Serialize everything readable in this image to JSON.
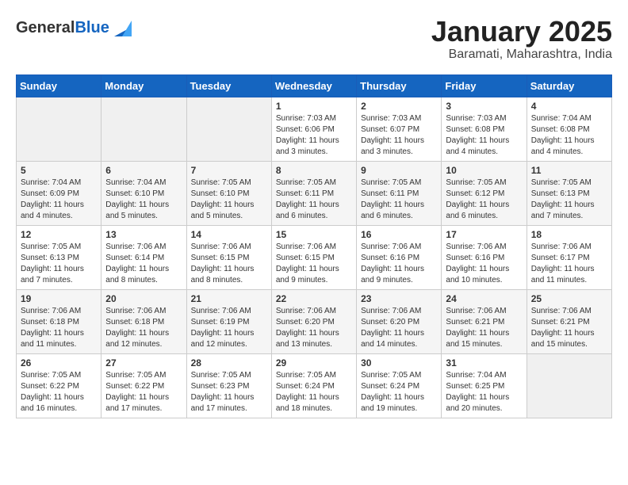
{
  "header": {
    "logo_general": "General",
    "logo_blue": "Blue",
    "month_title": "January 2025",
    "location": "Baramati, Maharashtra, India"
  },
  "days_of_week": [
    "Sunday",
    "Monday",
    "Tuesday",
    "Wednesday",
    "Thursday",
    "Friday",
    "Saturday"
  ],
  "weeks": [
    [
      {
        "day": "",
        "content": ""
      },
      {
        "day": "",
        "content": ""
      },
      {
        "day": "",
        "content": ""
      },
      {
        "day": "1",
        "content": "Sunrise: 7:03 AM\nSunset: 6:06 PM\nDaylight: 11 hours and 3 minutes."
      },
      {
        "day": "2",
        "content": "Sunrise: 7:03 AM\nSunset: 6:07 PM\nDaylight: 11 hours and 3 minutes."
      },
      {
        "day": "3",
        "content": "Sunrise: 7:03 AM\nSunset: 6:08 PM\nDaylight: 11 hours and 4 minutes."
      },
      {
        "day": "4",
        "content": "Sunrise: 7:04 AM\nSunset: 6:08 PM\nDaylight: 11 hours and 4 minutes."
      }
    ],
    [
      {
        "day": "5",
        "content": "Sunrise: 7:04 AM\nSunset: 6:09 PM\nDaylight: 11 hours and 4 minutes."
      },
      {
        "day": "6",
        "content": "Sunrise: 7:04 AM\nSunset: 6:10 PM\nDaylight: 11 hours and 5 minutes."
      },
      {
        "day": "7",
        "content": "Sunrise: 7:05 AM\nSunset: 6:10 PM\nDaylight: 11 hours and 5 minutes."
      },
      {
        "day": "8",
        "content": "Sunrise: 7:05 AM\nSunset: 6:11 PM\nDaylight: 11 hours and 6 minutes."
      },
      {
        "day": "9",
        "content": "Sunrise: 7:05 AM\nSunset: 6:11 PM\nDaylight: 11 hours and 6 minutes."
      },
      {
        "day": "10",
        "content": "Sunrise: 7:05 AM\nSunset: 6:12 PM\nDaylight: 11 hours and 6 minutes."
      },
      {
        "day": "11",
        "content": "Sunrise: 7:05 AM\nSunset: 6:13 PM\nDaylight: 11 hours and 7 minutes."
      }
    ],
    [
      {
        "day": "12",
        "content": "Sunrise: 7:05 AM\nSunset: 6:13 PM\nDaylight: 11 hours and 7 minutes."
      },
      {
        "day": "13",
        "content": "Sunrise: 7:06 AM\nSunset: 6:14 PM\nDaylight: 11 hours and 8 minutes."
      },
      {
        "day": "14",
        "content": "Sunrise: 7:06 AM\nSunset: 6:15 PM\nDaylight: 11 hours and 8 minutes."
      },
      {
        "day": "15",
        "content": "Sunrise: 7:06 AM\nSunset: 6:15 PM\nDaylight: 11 hours and 9 minutes."
      },
      {
        "day": "16",
        "content": "Sunrise: 7:06 AM\nSunset: 6:16 PM\nDaylight: 11 hours and 9 minutes."
      },
      {
        "day": "17",
        "content": "Sunrise: 7:06 AM\nSunset: 6:16 PM\nDaylight: 11 hours and 10 minutes."
      },
      {
        "day": "18",
        "content": "Sunrise: 7:06 AM\nSunset: 6:17 PM\nDaylight: 11 hours and 11 minutes."
      }
    ],
    [
      {
        "day": "19",
        "content": "Sunrise: 7:06 AM\nSunset: 6:18 PM\nDaylight: 11 hours and 11 minutes."
      },
      {
        "day": "20",
        "content": "Sunrise: 7:06 AM\nSunset: 6:18 PM\nDaylight: 11 hours and 12 minutes."
      },
      {
        "day": "21",
        "content": "Sunrise: 7:06 AM\nSunset: 6:19 PM\nDaylight: 11 hours and 12 minutes."
      },
      {
        "day": "22",
        "content": "Sunrise: 7:06 AM\nSunset: 6:20 PM\nDaylight: 11 hours and 13 minutes."
      },
      {
        "day": "23",
        "content": "Sunrise: 7:06 AM\nSunset: 6:20 PM\nDaylight: 11 hours and 14 minutes."
      },
      {
        "day": "24",
        "content": "Sunrise: 7:06 AM\nSunset: 6:21 PM\nDaylight: 11 hours and 15 minutes."
      },
      {
        "day": "25",
        "content": "Sunrise: 7:06 AM\nSunset: 6:21 PM\nDaylight: 11 hours and 15 minutes."
      }
    ],
    [
      {
        "day": "26",
        "content": "Sunrise: 7:05 AM\nSunset: 6:22 PM\nDaylight: 11 hours and 16 minutes."
      },
      {
        "day": "27",
        "content": "Sunrise: 7:05 AM\nSunset: 6:22 PM\nDaylight: 11 hours and 17 minutes."
      },
      {
        "day": "28",
        "content": "Sunrise: 7:05 AM\nSunset: 6:23 PM\nDaylight: 11 hours and 17 minutes."
      },
      {
        "day": "29",
        "content": "Sunrise: 7:05 AM\nSunset: 6:24 PM\nDaylight: 11 hours and 18 minutes."
      },
      {
        "day": "30",
        "content": "Sunrise: 7:05 AM\nSunset: 6:24 PM\nDaylight: 11 hours and 19 minutes."
      },
      {
        "day": "31",
        "content": "Sunrise: 7:04 AM\nSunset: 6:25 PM\nDaylight: 11 hours and 20 minutes."
      },
      {
        "day": "",
        "content": ""
      }
    ]
  ]
}
